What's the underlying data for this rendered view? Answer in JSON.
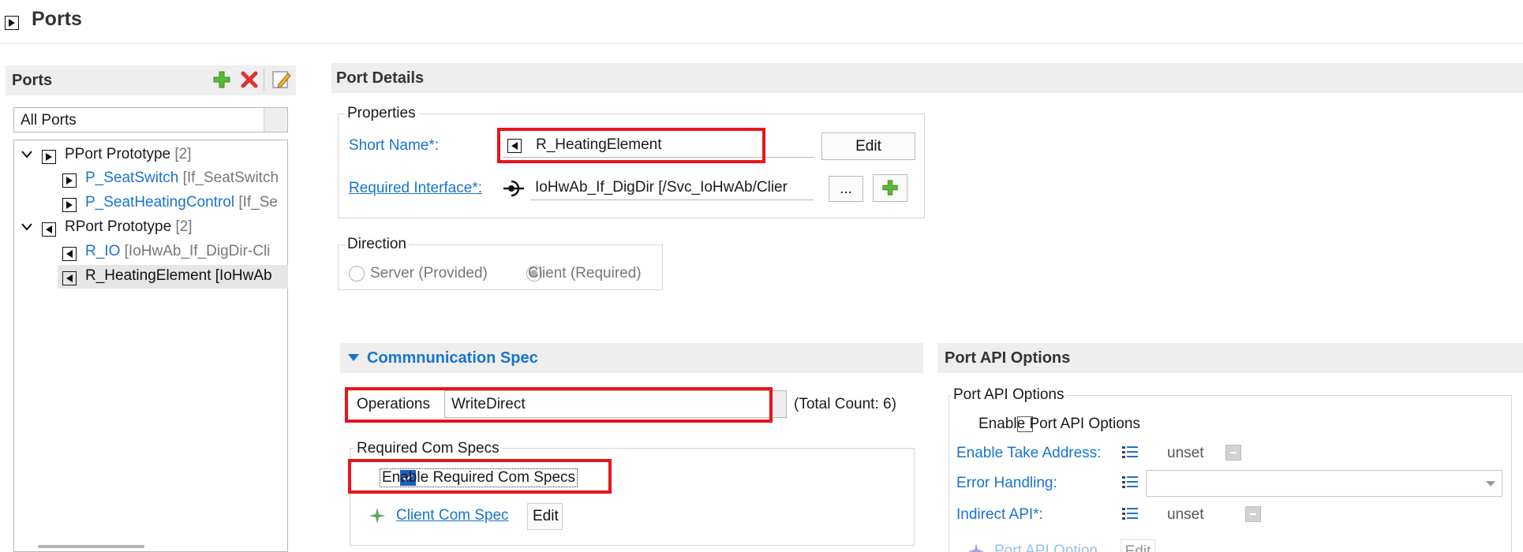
{
  "page": {
    "title": "Ports"
  },
  "left_panel": {
    "title": "Ports",
    "filter_value": "All Ports",
    "tree": [
      {
        "label": "PPort Prototype",
        "suffix": "[2]",
        "expanded": true,
        "dir": "provided",
        "children": [
          {
            "label": "P_SeatSwitch",
            "suffix": "[If_SeatSwitch",
            "dir": "provided"
          },
          {
            "label": "P_SeatHeatingControl",
            "suffix": "[If_Se",
            "dir": "provided"
          }
        ]
      },
      {
        "label": "RPort Prototype",
        "suffix": "[2]",
        "expanded": true,
        "dir": "required",
        "children": [
          {
            "label": "R_IO",
            "suffix": "[IoHwAb_If_DigDir-Cli",
            "dir": "required"
          },
          {
            "label": "R_HeatingElement",
            "suffix": "[IoHwAb",
            "dir": "required",
            "selected": true
          }
        ]
      }
    ]
  },
  "port_details": {
    "title": "Port Details",
    "properties_label": "Properties",
    "short_name_label": "Short Name*:",
    "short_name_value": "R_HeatingElement",
    "edit_label": "Edit",
    "required_interface_label": "Required Interface*:",
    "required_interface_value": "IoHwAb_If_DigDir [/Svc_IoHwAb/Clier",
    "browse_label": "...",
    "direction_label": "Direction",
    "direction_server": "Server (Provided)",
    "direction_client": "Client (Required)"
  },
  "comm_spec": {
    "title": "Commnunication Spec",
    "operations_label": "Operations",
    "operations_value": "WriteDirect",
    "total_count": "(Total Count: 6)",
    "required_com_specs_label": "Required Com Specs",
    "enable_required_label": "Enable Required Com Specs",
    "client_com_spec_label": "Client Com Spec",
    "edit_label": "Edit"
  },
  "port_api": {
    "title": "Port API Options",
    "group_label": "Port API Options",
    "enable_label": "Enable Port API Options",
    "take_address_label": "Enable Take Address:",
    "take_address_value": "unset",
    "error_handling_label": "Error Handling:",
    "indirect_api_label": "Indirect API*:",
    "indirect_api_value": "unset",
    "port_api_option_label": "Port API Option",
    "edit_label": "Edit"
  },
  "colors": {
    "link": "#1874cd",
    "highlight": "#e8141a",
    "checkbox": "#1f5fbf"
  }
}
